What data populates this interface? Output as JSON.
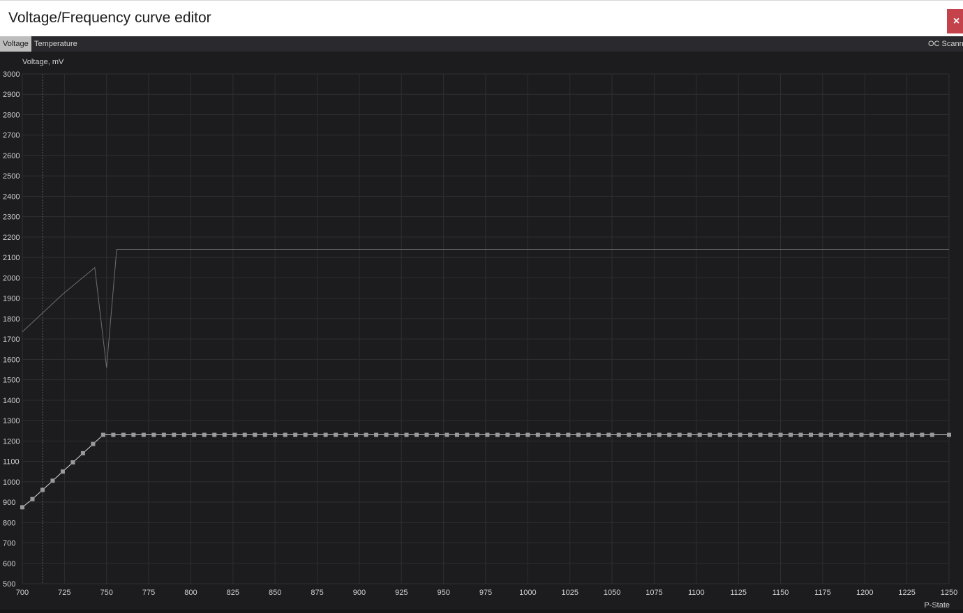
{
  "window": {
    "title": "Voltage/Frequency curve editor",
    "close_glyph": "×",
    "close_color": "#c4434b"
  },
  "tabs": {
    "voltage": "Voltage",
    "temperature": "Temperature",
    "oc_scanner": "OC Scanner"
  },
  "colors": {
    "background": "#1c1c1f",
    "grid": "#2f2f33",
    "axis_text": "#d0d0d0",
    "curve": "#d8d8d8",
    "point": "#9a9a9a",
    "frequency_line": "#6e6e72"
  },
  "chart_data": {
    "type": "line",
    "ylabel": "Voltage, mV",
    "xlabel": "P-State",
    "ylim": [
      500,
      3000
    ],
    "xlim": [
      700,
      1250
    ],
    "yticks": [
      500,
      600,
      700,
      800,
      900,
      1000,
      1100,
      1200,
      1300,
      1400,
      1500,
      1600,
      1700,
      1800,
      1900,
      2000,
      2100,
      2200,
      2300,
      2400,
      2500,
      2600,
      2700,
      2800,
      2900,
      3000
    ],
    "xticks": [
      700,
      725,
      750,
      775,
      800,
      825,
      850,
      875,
      900,
      925,
      950,
      975,
      1000,
      1025,
      1050,
      1075,
      1100,
      1125,
      1150,
      1175,
      1200,
      1225,
      1250
    ],
    "grid": true,
    "cursor_x": 712,
    "series": [
      {
        "style": "points",
        "values": [
          [
            700,
            875
          ],
          [
            706,
            915
          ],
          [
            712,
            960
          ],
          [
            718,
            1005
          ],
          [
            724,
            1050
          ],
          [
            730,
            1095
          ],
          [
            736,
            1140
          ],
          [
            742,
            1185
          ],
          [
            748,
            1230
          ],
          [
            754,
            1230
          ],
          [
            760,
            1230
          ],
          [
            766,
            1230
          ],
          [
            772,
            1230
          ],
          [
            778,
            1230
          ],
          [
            784,
            1230
          ],
          [
            790,
            1230
          ],
          [
            796,
            1230
          ],
          [
            802,
            1230
          ],
          [
            808,
            1230
          ],
          [
            814,
            1230
          ],
          [
            820,
            1230
          ],
          [
            826,
            1230
          ],
          [
            832,
            1230
          ],
          [
            838,
            1230
          ],
          [
            844,
            1230
          ],
          [
            850,
            1230
          ],
          [
            856,
            1230
          ],
          [
            862,
            1230
          ],
          [
            868,
            1230
          ],
          [
            874,
            1230
          ],
          [
            880,
            1230
          ],
          [
            886,
            1230
          ],
          [
            892,
            1230
          ],
          [
            898,
            1230
          ],
          [
            904,
            1230
          ],
          [
            910,
            1230
          ],
          [
            916,
            1230
          ],
          [
            922,
            1230
          ],
          [
            928,
            1230
          ],
          [
            934,
            1230
          ],
          [
            940,
            1230
          ],
          [
            946,
            1230
          ],
          [
            952,
            1230
          ],
          [
            958,
            1230
          ],
          [
            964,
            1230
          ],
          [
            970,
            1230
          ],
          [
            976,
            1230
          ],
          [
            982,
            1230
          ],
          [
            988,
            1230
          ],
          [
            994,
            1230
          ],
          [
            1000,
            1230
          ],
          [
            1006,
            1230
          ],
          [
            1012,
            1230
          ],
          [
            1018,
            1230
          ],
          [
            1024,
            1230
          ],
          [
            1030,
            1230
          ],
          [
            1036,
            1230
          ],
          [
            1042,
            1230
          ],
          [
            1048,
            1230
          ],
          [
            1054,
            1230
          ],
          [
            1060,
            1230
          ],
          [
            1066,
            1230
          ],
          [
            1072,
            1230
          ],
          [
            1078,
            1230
          ],
          [
            1084,
            1230
          ],
          [
            1090,
            1230
          ],
          [
            1096,
            1230
          ],
          [
            1102,
            1230
          ],
          [
            1108,
            1230
          ],
          [
            1114,
            1230
          ],
          [
            1120,
            1230
          ],
          [
            1126,
            1230
          ],
          [
            1132,
            1230
          ],
          [
            1138,
            1230
          ],
          [
            1144,
            1230
          ],
          [
            1150,
            1230
          ],
          [
            1156,
            1230
          ],
          [
            1162,
            1230
          ],
          [
            1168,
            1230
          ],
          [
            1174,
            1230
          ],
          [
            1180,
            1230
          ],
          [
            1186,
            1230
          ],
          [
            1192,
            1230
          ],
          [
            1198,
            1230
          ],
          [
            1204,
            1230
          ],
          [
            1210,
            1230
          ],
          [
            1216,
            1230
          ],
          [
            1222,
            1230
          ],
          [
            1228,
            1230
          ],
          [
            1234,
            1230
          ],
          [
            1240,
            1230
          ],
          [
            1250,
            1230
          ]
        ]
      },
      {
        "style": "line",
        "values": [
          [
            700,
            1735
          ],
          [
            724,
            1920
          ],
          [
            743,
            2050
          ],
          [
            750,
            1560
          ],
          [
            756,
            2140
          ],
          [
            1250,
            2140
          ]
        ]
      }
    ]
  }
}
